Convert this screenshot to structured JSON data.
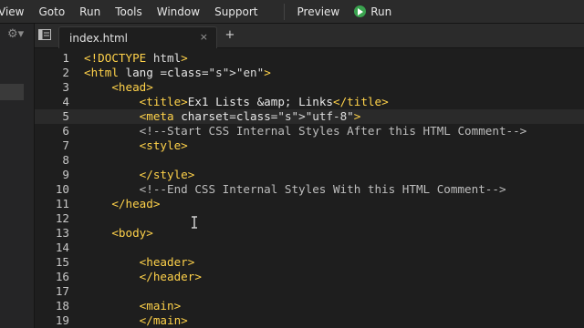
{
  "menubar": {
    "items": [
      "View",
      "Goto",
      "Run",
      "Tools",
      "Window",
      "Support"
    ],
    "preview_label": "Preview",
    "run_label": "Run"
  },
  "tabs": [
    {
      "label": "index.html",
      "close": "×"
    }
  ],
  "new_tab_label": "+",
  "editor": {
    "active_line": 5,
    "lines": [
      {
        "n": "1",
        "code": "<!DOCTYPE html>"
      },
      {
        "n": "2",
        "code": "<html lang =\"en\">"
      },
      {
        "n": "3",
        "code": "    <head>"
      },
      {
        "n": "4",
        "code": "        <title>Ex1 Lists &amp; Links</title>"
      },
      {
        "n": "5",
        "code": "        <meta charset=\"utf-8\">"
      },
      {
        "n": "6",
        "code": "        <!--Start CSS Internal Styles After this HTML Comment-->"
      },
      {
        "n": "7",
        "code": "        <style>"
      },
      {
        "n": "8",
        "code": ""
      },
      {
        "n": "9",
        "code": "        </style>"
      },
      {
        "n": "10",
        "code": "        <!--End CSS Internal Styles With this HTML Comment-->"
      },
      {
        "n": "11",
        "code": "    </head>"
      },
      {
        "n": "12",
        "code": ""
      },
      {
        "n": "13",
        "code": "    <body>"
      },
      {
        "n": "14",
        "code": ""
      },
      {
        "n": "15",
        "code": "        <header>"
      },
      {
        "n": "16",
        "code": "        </header>"
      },
      {
        "n": "17",
        "code": ""
      },
      {
        "n": "18",
        "code": "        <main>"
      },
      {
        "n": "19",
        "code": "        </main>"
      }
    ]
  },
  "colors": {
    "tag": "#ffd24a",
    "string": "#e7c86b",
    "comment": "#bdbdbd",
    "run_icon": "#3aa34f"
  }
}
